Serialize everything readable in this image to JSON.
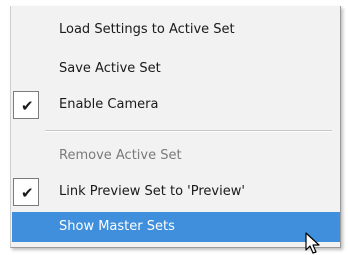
{
  "menu": {
    "items": [
      {
        "label": "Load Settings to Active Set",
        "checked": false,
        "disabled": false,
        "highlighted": false
      },
      {
        "label": "Save Active Set",
        "checked": false,
        "disabled": false,
        "highlighted": false
      },
      {
        "label": "Enable Camera",
        "checked": true,
        "disabled": false,
        "highlighted": false
      },
      {
        "label": "Remove Active Set",
        "checked": false,
        "disabled": true,
        "highlighted": false
      },
      {
        "label": "Link Preview Set to 'Preview'",
        "checked": true,
        "disabled": false,
        "highlighted": false
      },
      {
        "label": "Show Master Sets",
        "checked": false,
        "disabled": false,
        "highlighted": true
      }
    ],
    "check_glyph": "✔"
  },
  "colors": {
    "highlight": "#3f8fdc",
    "menu_background": "#f2f2f2",
    "disabled_text": "#7a7a7a"
  },
  "icons": {
    "cursor": "arrow-pointer-icon",
    "check": "checkmark-icon"
  }
}
